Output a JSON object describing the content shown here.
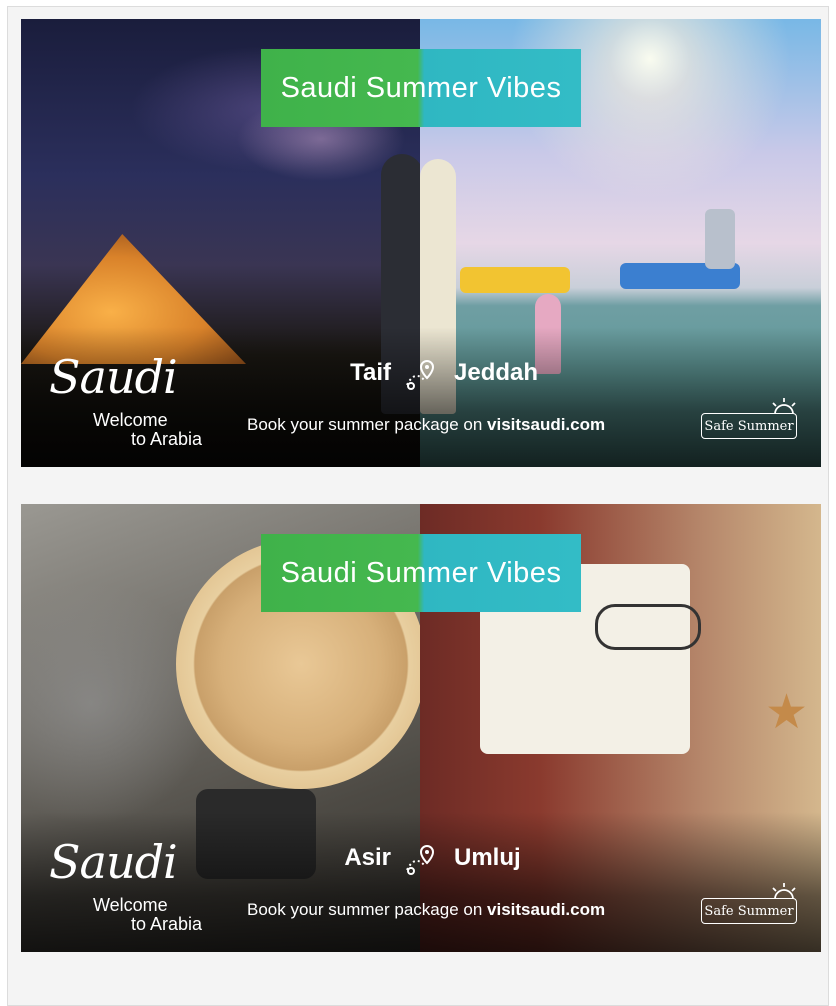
{
  "ads": [
    {
      "title": "Saudi Summer Vibes",
      "city_left": "Taif",
      "city_right": "Jeddah",
      "tagline_prefix": "Book your summer package on ",
      "tagline_site": "visitsaudi.com",
      "logo_word": "Saudi",
      "logo_sub1": "Welcome",
      "logo_sub2": "to Arabia",
      "badge": "Safe Summer"
    },
    {
      "title": "Saudi Summer Vibes",
      "city_left": "Asir",
      "city_right": "Umluj",
      "tagline_prefix": "Book your summer package on ",
      "tagline_site": "visitsaudi.com",
      "logo_word": "Saudi",
      "logo_sub1": "Welcome",
      "logo_sub2": "to Arabia",
      "badge": "Safe Summer"
    }
  ],
  "colors": {
    "banner_green": "#45b84f",
    "banner_teal": "#33bcc6",
    "text": "#ffffff"
  },
  "icons": [
    "location-pin-icon",
    "sun-icon"
  ]
}
